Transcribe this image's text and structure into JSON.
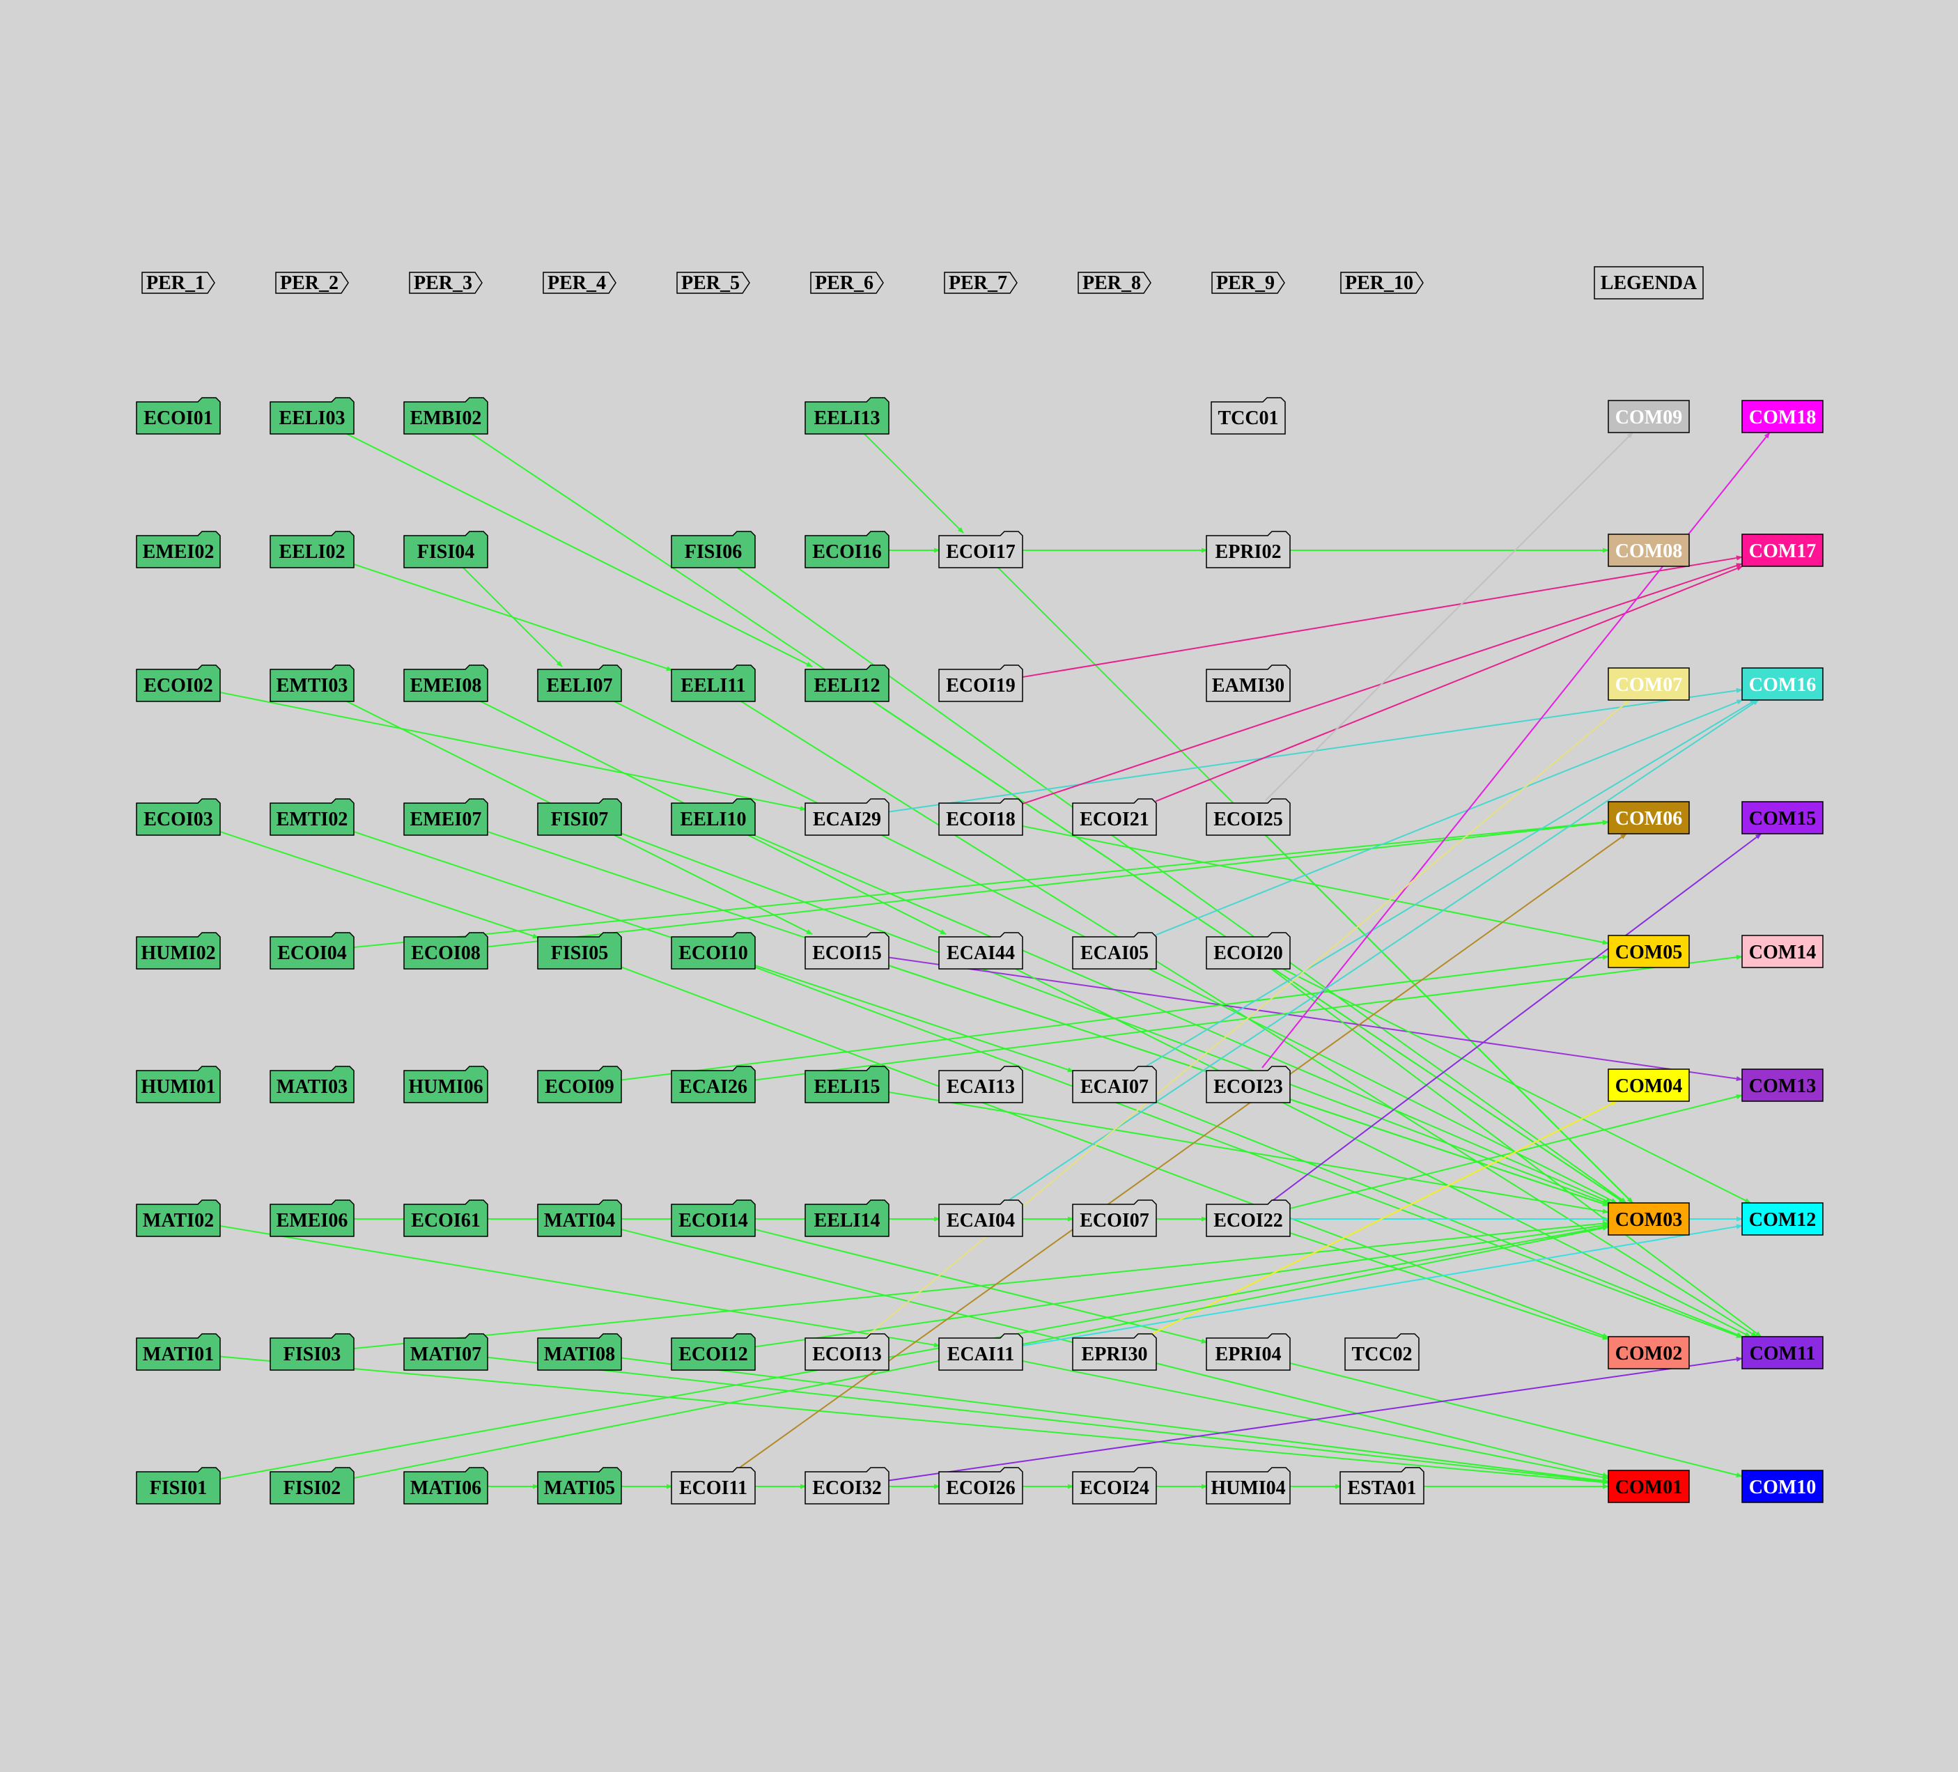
{
  "colors": {
    "background": "#d3d3d3",
    "done_fill": "#4fc575",
    "pending_fill": "#d3d3d3",
    "border": "#000000",
    "edge_default": "#2ef52e"
  },
  "periods": [
    "PER_1",
    "PER_2",
    "PER_3",
    "PER_4",
    "PER_5",
    "PER_6",
    "PER_7",
    "PER_8",
    "PER_9",
    "PER_10"
  ],
  "legend_title": "LEGENDA",
  "courses": [
    {
      "id": "ECOI01",
      "done": true
    },
    {
      "id": "EELI03",
      "done": true
    },
    {
      "id": "EMBI02",
      "done": true
    },
    {
      "id": "EELI13",
      "done": true
    },
    {
      "id": "TCC01",
      "done": false
    },
    {
      "id": "EMEI02",
      "done": true
    },
    {
      "id": "EELI02",
      "done": true
    },
    {
      "id": "FISI04",
      "done": true
    },
    {
      "id": "FISI06",
      "done": true
    },
    {
      "id": "ECOI16",
      "done": true
    },
    {
      "id": "ECOI17",
      "done": false
    },
    {
      "id": "EPRI02",
      "done": false
    },
    {
      "id": "ECOI02",
      "done": true
    },
    {
      "id": "EMTI03",
      "done": true
    },
    {
      "id": "EMEI08",
      "done": true
    },
    {
      "id": "EELI07",
      "done": true
    },
    {
      "id": "EELI11",
      "done": true
    },
    {
      "id": "EELI12",
      "done": true
    },
    {
      "id": "ECOI19",
      "done": false
    },
    {
      "id": "EAMI30",
      "done": false
    },
    {
      "id": "ECOI03",
      "done": true
    },
    {
      "id": "EMTI02",
      "done": true
    },
    {
      "id": "EMEI07",
      "done": true
    },
    {
      "id": "FISI07",
      "done": true
    },
    {
      "id": "EELI10",
      "done": true
    },
    {
      "id": "ECAI29",
      "done": false
    },
    {
      "id": "ECOI18",
      "done": false
    },
    {
      "id": "ECOI21",
      "done": false
    },
    {
      "id": "ECOI25",
      "done": false
    },
    {
      "id": "HUMI02",
      "done": true
    },
    {
      "id": "ECOI04",
      "done": true
    },
    {
      "id": "ECOI08",
      "done": true
    },
    {
      "id": "FISI05",
      "done": true
    },
    {
      "id": "ECOI10",
      "done": true
    },
    {
      "id": "ECOI15",
      "done": false
    },
    {
      "id": "ECAI44",
      "done": false
    },
    {
      "id": "ECAI05",
      "done": false
    },
    {
      "id": "ECOI20",
      "done": false
    },
    {
      "id": "HUMI01",
      "done": true
    },
    {
      "id": "MATI03",
      "done": true
    },
    {
      "id": "HUMI06",
      "done": true
    },
    {
      "id": "ECOI09",
      "done": true
    },
    {
      "id": "ECAI26",
      "done": true
    },
    {
      "id": "EELI15",
      "done": true
    },
    {
      "id": "ECAI13",
      "done": false
    },
    {
      "id": "ECAI07",
      "done": false
    },
    {
      "id": "ECOI23",
      "done": false
    },
    {
      "id": "MATI02",
      "done": true
    },
    {
      "id": "EMEI06",
      "done": true
    },
    {
      "id": "ECOI61",
      "done": true
    },
    {
      "id": "MATI04",
      "done": true
    },
    {
      "id": "ECOI14",
      "done": true
    },
    {
      "id": "EELI14",
      "done": true
    },
    {
      "id": "ECAI04",
      "done": false
    },
    {
      "id": "ECOI07",
      "done": false
    },
    {
      "id": "ECOI22",
      "done": false
    },
    {
      "id": "MATI01",
      "done": true
    },
    {
      "id": "FISI03",
      "done": true
    },
    {
      "id": "MATI07",
      "done": true
    },
    {
      "id": "MATI08",
      "done": true
    },
    {
      "id": "ECOI12",
      "done": true
    },
    {
      "id": "ECOI13",
      "done": false
    },
    {
      "id": "ECAI11",
      "done": false
    },
    {
      "id": "EPRI30",
      "done": false
    },
    {
      "id": "EPRI04",
      "done": false
    },
    {
      "id": "TCC02",
      "done": false
    },
    {
      "id": "FISI01",
      "done": true
    },
    {
      "id": "FISI02",
      "done": true
    },
    {
      "id": "MATI06",
      "done": true
    },
    {
      "id": "MATI05",
      "done": true
    },
    {
      "id": "ECOI11",
      "done": false
    },
    {
      "id": "ECOI32",
      "done": false
    },
    {
      "id": "ECOI26",
      "done": false
    },
    {
      "id": "ECOI24",
      "done": false
    },
    {
      "id": "HUMI04",
      "done": false
    },
    {
      "id": "ESTA01",
      "done": false
    }
  ],
  "competencies": [
    {
      "id": "COM09",
      "fill": "#c0c0c0",
      "text": "#ffffff"
    },
    {
      "id": "COM18",
      "fill": "#ff00ff",
      "text": "#ffffff"
    },
    {
      "id": "COM08",
      "fill": "#d2b48c",
      "text": "#ffffff"
    },
    {
      "id": "COM17",
      "fill": "#ff1493",
      "text": "#ffffff"
    },
    {
      "id": "COM07",
      "fill": "#f0e68c",
      "text": "#ffffff"
    },
    {
      "id": "COM16",
      "fill": "#40e0d0",
      "text": "#ffffff"
    },
    {
      "id": "COM06",
      "fill": "#b8860b",
      "text": "#ffffff"
    },
    {
      "id": "COM15",
      "fill": "#a020f0",
      "text": "#000000"
    },
    {
      "id": "COM05",
      "fill": "#ffd700",
      "text": "#000000"
    },
    {
      "id": "COM14",
      "fill": "#ffc0cb",
      "text": "#000000"
    },
    {
      "id": "COM04",
      "fill": "#ffff00",
      "text": "#000000"
    },
    {
      "id": "COM13",
      "fill": "#9932cc",
      "text": "#000000"
    },
    {
      "id": "COM03",
      "fill": "#ffa500",
      "text": "#000000"
    },
    {
      "id": "COM12",
      "fill": "#00ffff",
      "text": "#000000"
    },
    {
      "id": "COM02",
      "fill": "#fa8072",
      "text": "#000000"
    },
    {
      "id": "COM11",
      "fill": "#8a2be2",
      "text": "#000000"
    },
    {
      "id": "COM01",
      "fill": "#ff0000",
      "text": "#000000"
    },
    {
      "id": "COM10",
      "fill": "#0000ff",
      "text": "#ffffff"
    }
  ],
  "edges": [
    [
      "EELI13",
      "ECOI17",
      "#2ef52e"
    ],
    [
      "ECOI16",
      "ECOI17",
      "#2ef52e"
    ],
    [
      "ECOI17",
      "EPRI02",
      "#2ef52e"
    ],
    [
      "EPRI02",
      "COM08",
      "#2ef52e"
    ],
    [
      "MATI06",
      "MATI05",
      "#2ef52e"
    ],
    [
      "MATI05",
      "ECOI11",
      "#2ef52e"
    ],
    [
      "ECOI11",
      "ECOI32",
      "#2ef52e"
    ],
    [
      "ECOI32",
      "ECOI26",
      "#2ef52e"
    ],
    [
      "ECOI26",
      "ECOI24",
      "#2ef52e"
    ],
    [
      "ECOI24",
      "HUMI04",
      "#2ef52e"
    ],
    [
      "HUMI04",
      "ESTA01",
      "#2ef52e"
    ],
    [
      "ESTA01",
      "COM01",
      "#2ef52e"
    ],
    [
      "EELI14",
      "ECAI04",
      "#2ef52e"
    ],
    [
      "ECAI04",
      "ECOI07",
      "#2ef52e"
    ],
    [
      "ECOI07",
      "ECOI22",
      "#2ef52e"
    ],
    [
      "EELI03",
      "EELI12",
      "#2ef52e"
    ],
    [
      "EMBI02",
      "COM03",
      "#2ef52e"
    ],
    [
      "EELI02",
      "EELI11",
      "#2ef52e"
    ],
    [
      "FISI04",
      "EELI07",
      "#2ef52e"
    ],
    [
      "FISI06",
      "COM03",
      "#2ef52e"
    ],
    [
      "ECOI17",
      "COM03",
      "#2ef52e"
    ],
    [
      "ECOI02",
      "ECAI29",
      "#2ef52e"
    ],
    [
      "EMTI03",
      "ECOI15",
      "#2ef52e"
    ],
    [
      "EMEI08",
      "ECAI44",
      "#2ef52e"
    ],
    [
      "EELI07",
      "COM03",
      "#2ef52e"
    ],
    [
      "EELI11",
      "COM11",
      "#2ef52e"
    ],
    [
      "EELI12",
      "COM03",
      "#2ef52e"
    ],
    [
      "ECOI19",
      "COM17",
      "#e8208e"
    ],
    [
      "ECOI03",
      "FISI05",
      "#2ef52e"
    ],
    [
      "EMTI02",
      "ECAI07",
      "#2ef52e"
    ],
    [
      "EMEI07",
      "COM03",
      "#2ef52e"
    ],
    [
      "FISI07",
      "COM03",
      "#2ef52e"
    ],
    [
      "EELI10",
      "COM03",
      "#2ef52e"
    ],
    [
      "ECAI29",
      "COM16",
      "#47d6d0"
    ],
    [
      "ECOI18",
      "COM17",
      "#e8208e"
    ],
    [
      "ECOI18",
      "COM05",
      "#2ef52e"
    ],
    [
      "ECOI21",
      "COM17",
      "#e8208e"
    ],
    [
      "ECOI25",
      "COM09",
      "#c0c0c0"
    ],
    [
      "ECOI25",
      "COM03",
      "#2ef52e"
    ],
    [
      "ECOI04",
      "COM06",
      "#2ef52e"
    ],
    [
      "ECOI08",
      "COM06",
      "#2ef52e"
    ],
    [
      "FISI05",
      "COM02",
      "#2ef52e"
    ],
    [
      "ECOI10",
      "COM11",
      "#2ef52e"
    ],
    [
      "ECOI15",
      "COM13",
      "#9a35dc"
    ],
    [
      "ECOI15",
      "COM03",
      "#2ef52e"
    ],
    [
      "ECAI44",
      "COM11",
      "#2ef52e"
    ],
    [
      "ECAI05",
      "COM16",
      "#47d6d0"
    ],
    [
      "ECOI20",
      "COM12",
      "#2ef52e"
    ],
    [
      "ECOI20",
      "COM11",
      "#2ef52e"
    ],
    [
      "ECOI09",
      "COM05",
      "#2ef52e"
    ],
    [
      "ECAI26",
      "COM14",
      "#2ef52e"
    ],
    [
      "EELI15",
      "COM03",
      "#2ef52e"
    ],
    [
      "ECAI07",
      "COM16",
      "#47d6d0"
    ],
    [
      "ECAI07",
      "COM11",
      "#2ef52e"
    ],
    [
      "ECOI23",
      "COM18",
      "#e61ee6"
    ],
    [
      "MATI02",
      "ECAI11",
      "#2ef52e"
    ],
    [
      "EMEI06",
      "COM03",
      "#2ef52e"
    ],
    [
      "MATI04",
      "COM01",
      "#2ef52e"
    ],
    [
      "ECOI14",
      "EPRI04",
      "#2ef52e"
    ],
    [
      "ECAI04",
      "COM16",
      "#47d6d0"
    ],
    [
      "ECOI22",
      "COM15",
      "#8a2be2"
    ],
    [
      "ECOI22",
      "COM12",
      "#38e0e0"
    ],
    [
      "ECOI22",
      "COM02",
      "#2ef52e"
    ],
    [
      "ECOI22",
      "COM13",
      "#2ef52e"
    ],
    [
      "MATI01",
      "COM01",
      "#2ef52e"
    ],
    [
      "FISI03",
      "COM03",
      "#2ef52e"
    ],
    [
      "MATI07",
      "COM01",
      "#2ef52e"
    ],
    [
      "MATI08",
      "COM01",
      "#2ef52e"
    ],
    [
      "ECOI12",
      "COM03",
      "#2ef52e"
    ],
    [
      "ECOI13",
      "COM07",
      "#e6e080"
    ],
    [
      "ECAI11",
      "COM12",
      "#38e0e0"
    ],
    [
      "ECAI11",
      "COM01",
      "#2ef52e"
    ],
    [
      "EPRI30",
      "COM04",
      "#f0f020"
    ],
    [
      "EPRI04",
      "COM10",
      "#2ef52e"
    ],
    [
      "FISI01",
      "COM03",
      "#2ef52e"
    ],
    [
      "FISI02",
      "COM03",
      "#2ef52e"
    ],
    [
      "ECOI11",
      "COM06",
      "#b38a26"
    ],
    [
      "ECOI32",
      "COM11",
      "#8a2be2"
    ]
  ]
}
